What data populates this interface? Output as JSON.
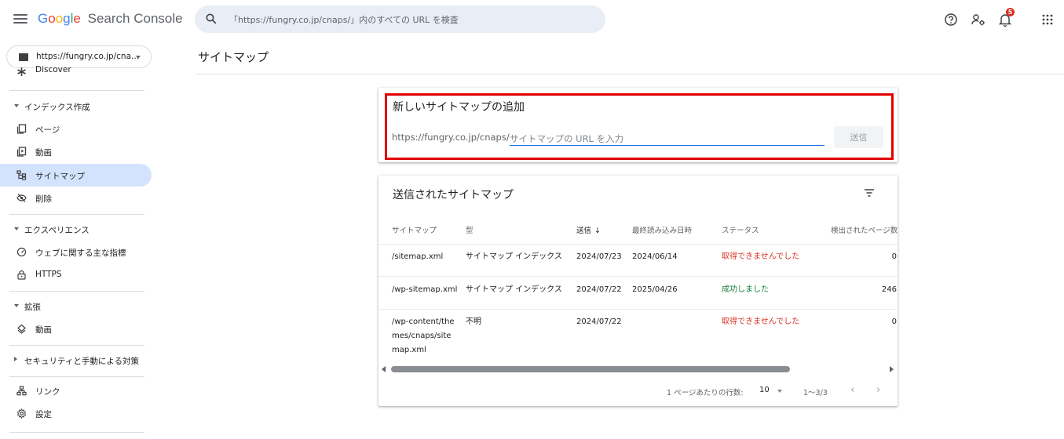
{
  "header": {
    "logo_letters": [
      "G",
      "o",
      "o",
      "g",
      "l",
      "e"
    ],
    "product": "Search Console",
    "search_placeholder": "「https://fungry.co.jp/cnaps/」内のすべての URL を検査",
    "notification_count": "5",
    "icons": [
      "menu-icon",
      "search-icon",
      "help-icon",
      "manage-users-icon",
      "notifications-icon",
      "apps-grid-icon"
    ]
  },
  "property": {
    "label": "https://fungry.co.jp/cna..."
  },
  "sidebar": {
    "discover": "Discover",
    "index_section": "インデックス作成",
    "pages": "ページ",
    "videos": "動画",
    "sitemaps": "サイトマップ",
    "removals": "削除",
    "experience_section": "エクスペリエンス",
    "core_web_vitals": "ウェブに関する主な指標",
    "https": "HTTPS",
    "enhancements_section": "拡張",
    "enh_videos": "動画",
    "security_section": "セキュリティと手動による対策",
    "links": "リンク",
    "settings": "設定"
  },
  "page": {
    "title": "サイトマップ"
  },
  "add_sitemap": {
    "title": "新しいサイトマップの追加",
    "url_prefix": "https://fungry.co.jp/cnaps/",
    "input_placeholder": "サイトマップの URL を入力",
    "input_value": "",
    "submit_label": "送信"
  },
  "submitted": {
    "title": "送信されたサイトマップ",
    "columns": {
      "sitemap": "サイトマップ",
      "type": "型",
      "submitted": "送信",
      "sort_arrow": "↓",
      "last_read": "最終読み込み日時",
      "status": "ステータス",
      "discovered": "検出されたページ数"
    },
    "rows": [
      {
        "sitemap": "/sitemap.xml",
        "type": "サイトマップ インデックス",
        "submitted": "2024/07/23",
        "last_read": "2024/06/14",
        "status": "取得できませんでした",
        "discovered": "0"
      },
      {
        "sitemap": "/wp-sitemap.xml",
        "type": "サイトマップ インデックス",
        "submitted": "2024/07/22",
        "last_read": "2025/04/26",
        "status": "成功しました",
        "discovered": "246"
      },
      {
        "sitemap": "/wp-content/themes/cnaps/sitemap.xml",
        "type": "不明",
        "submitted": "2024/07/22",
        "last_read": "",
        "status": "取得できませんでした",
        "discovered": "0"
      }
    ],
    "status_colors": {
      "error": "#d93025",
      "success": "#188038"
    },
    "pager": {
      "rows_per_page_label": "1 ページあたりの行数:",
      "rows_per_page_value": "10",
      "range": "1〜3/3",
      "prev": "‹",
      "next": "›"
    }
  },
  "colors": {
    "accent": "#1a73e8",
    "active_nav": "#d3e3fd",
    "search_bg": "#e9eef6",
    "highlight_box": "#e00000"
  }
}
